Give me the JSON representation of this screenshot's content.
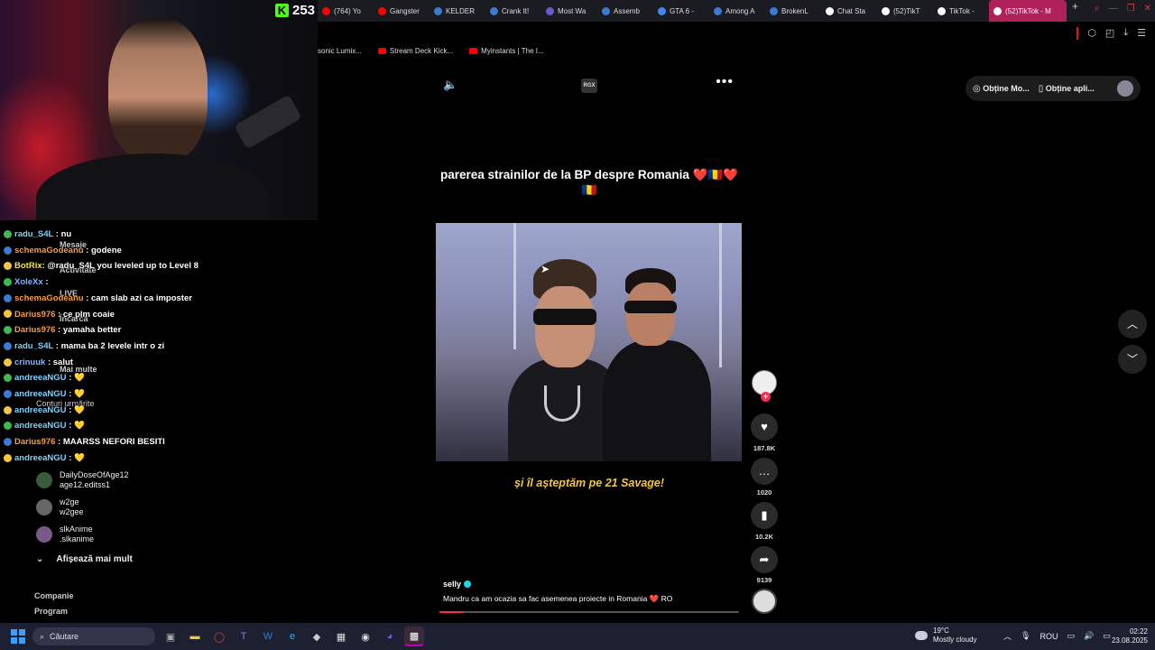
{
  "kick": {
    "viewer_count": "253"
  },
  "browser": {
    "tabs": [
      {
        "label": "(764) Yo",
        "icon_color": "#ff0000"
      },
      {
        "label": "Gangster",
        "icon_color": "#ff0000"
      },
      {
        "label": "KELDER",
        "icon_color": "#3a7bd5"
      },
      {
        "label": "Crank It!",
        "icon_color": "#3a7bd5"
      },
      {
        "label": "Most Wa",
        "icon_color": "#6a5acd"
      },
      {
        "label": "Assemb",
        "icon_color": "#3a7bd5"
      },
      {
        "label": "GTA 6 - ",
        "icon_color": "#4285f4"
      },
      {
        "label": "Among A",
        "icon_color": "#3a7bd5"
      },
      {
        "label": "BrokenL",
        "icon_color": "#3a7bd5"
      },
      {
        "label": "Chat Sta",
        "icon_color": "#ffffff"
      },
      {
        "label": "(52)TikT",
        "icon_color": "#ffffff"
      },
      {
        "label": "TikTok - ",
        "icon_color": "#ffffff"
      },
      {
        "label": "(52)TikTok - M",
        "icon_color": "#ffffff",
        "active": true
      }
    ],
    "new_tab": "+",
    "bookmarks": [
      {
        "label": "sonic Lumix...",
        "icon": "none"
      },
      {
        "label": "Stream Deck Kick...",
        "icon": "youtube-icon"
      },
      {
        "label": "Myinstants | The I...",
        "icon": "youtube-icon"
      }
    ]
  },
  "chat": {
    "messages": [
      {
        "user": "radu_S4L",
        "text": " : nu",
        "color": "#7fd0ff"
      },
      {
        "user": "schemaGodeanu",
        "text": " : godene",
        "color": "#ff9a3c"
      },
      {
        "user": "BotRix",
        "text": ": @radu_S4L you leveled up to Level 8",
        "color": "#f5e642"
      },
      {
        "user": "XoleXx",
        "text": " :",
        "color": "#8ab4ff"
      },
      {
        "user": "schemaGodeanu",
        "text": " : cam slab azi ca imposter",
        "color": "#ff9a3c"
      },
      {
        "user": "Darius976",
        "text": " : ce plm coaie",
        "color": "#ff9a3c"
      },
      {
        "user": "Darius976",
        "text": " : yamaha better",
        "color": "#ff9a3c"
      },
      {
        "user": "radu_S4L",
        "text": " : mama ba 2 levele intr o zi",
        "color": "#7fd0ff"
      },
      {
        "user": "crinuuk",
        "text": " : salut",
        "color": "#8ab4ff"
      },
      {
        "user": "andreeaNGU",
        "text": " : 💛",
        "color": "#7fd0ff"
      },
      {
        "user": "andreeaNGU",
        "text": " : 💛",
        "color": "#7fd0ff"
      },
      {
        "user": "andreeaNGU",
        "text": " : 💛",
        "color": "#7fd0ff"
      },
      {
        "user": "andreeaNGU",
        "text": " : 💛",
        "color": "#7fd0ff"
      },
      {
        "user": "Darius976",
        "text": " : MAARSS NEFORI BESITI",
        "color": "#ff9a3c"
      },
      {
        "user": "andreeaNGU",
        "text": " : 💛",
        "color": "#7fd0ff"
      }
    ]
  },
  "sidebar": {
    "links_under_chat": [
      "Mesaje",
      "Activitate",
      "LIVE",
      "Încarcă",
      "Mai multe",
      "Conturi urmărite",
      "Mai mult"
    ],
    "followed": [
      {
        "name": "DailyDoseOfAge12",
        "handle": "age12.editss1"
      },
      {
        "name": "w2ge",
        "handle": "w2gee"
      },
      {
        "name": "slkAnime",
        "handle": ".slkanime"
      }
    ],
    "show_more": "Afișează mai mult",
    "footer": [
      "Companie",
      "Program"
    ]
  },
  "tiktok": {
    "top_label": "RGX",
    "caption": "parerea strainilor de la BP despre Romania ❤️🇷🇴❤️🇷🇴",
    "subtitle": "și îl așteptăm pe 21 Savage!",
    "author": "selly",
    "description": "Mandru ca am ocazia sa fac asemenea proiecte in Romania ❤️ RO",
    "progress_percent": 8,
    "likes": "187.8K",
    "comments": "1020",
    "saves": "10.2K",
    "shares": "9139",
    "get_coins": "Obține Mo...",
    "get_app": "Obține apli..."
  },
  "taskbar": {
    "search_placeholder": "Căutare",
    "weather_temp": "19°C",
    "weather_desc": "Mostly cloudy",
    "language": "ROU",
    "time": "02:22",
    "date": "23.08.2025"
  }
}
